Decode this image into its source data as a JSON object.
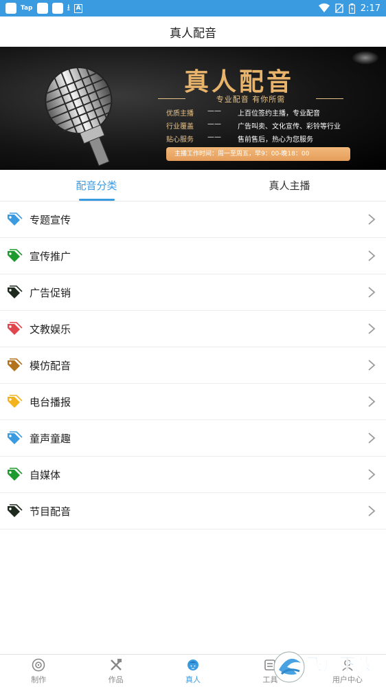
{
  "status_bar": {
    "left_app_label": "Tap",
    "time": "2:17"
  },
  "header": {
    "title": "真人配音"
  },
  "banner": {
    "title": "真人配音",
    "subtitle": "专业配音  有你所需",
    "rows": [
      {
        "label": "优质主播",
        "dash": "——",
        "text": "上百位签约主播，专业配音"
      },
      {
        "label": "行业覆盖",
        "dash": "——",
        "text": "广告叫卖、文化宣传、彩铃等行业"
      },
      {
        "label": "贴心服务",
        "dash": "——",
        "text": "售前售后，热心为您服务"
      }
    ],
    "hours": "主播工作时间：周一至周五，早9：00-晚18：00"
  },
  "tabs": [
    {
      "label": "配音分类",
      "active": true
    },
    {
      "label": "真人主播",
      "active": false
    }
  ],
  "categories": [
    {
      "label": "专题宣传",
      "color": "#3a9be0"
    },
    {
      "label": "宣传推广",
      "color": "#1f9a2e"
    },
    {
      "label": "广告促销",
      "color": "#1f2a1f"
    },
    {
      "label": "文教娱乐",
      "color": "#e0474c"
    },
    {
      "label": "模仿配音",
      "color": "#b3731c"
    },
    {
      "label": "电台播报",
      "color": "#f2b31e"
    },
    {
      "label": "童声童趣",
      "color": "#3a9be0"
    },
    {
      "label": "自媒体",
      "color": "#1f9a2e"
    },
    {
      "label": "节目配音",
      "color": "#1f2a1f"
    }
  ],
  "bottom_nav": [
    {
      "label": "制作",
      "icon": "make-icon",
      "active": false
    },
    {
      "label": "作品",
      "icon": "works-icon",
      "active": false
    },
    {
      "label": "真人",
      "icon": "person-icon",
      "active": true
    },
    {
      "label": "工具",
      "icon": "tools-icon",
      "active": false
    },
    {
      "label": "用户中心",
      "icon": "user-center-icon",
      "active": false
    }
  ],
  "watermark": {
    "text": "飞翔下载"
  },
  "colors": {
    "accent": "#3a9be0",
    "banner_gold": "#e8b46c"
  }
}
